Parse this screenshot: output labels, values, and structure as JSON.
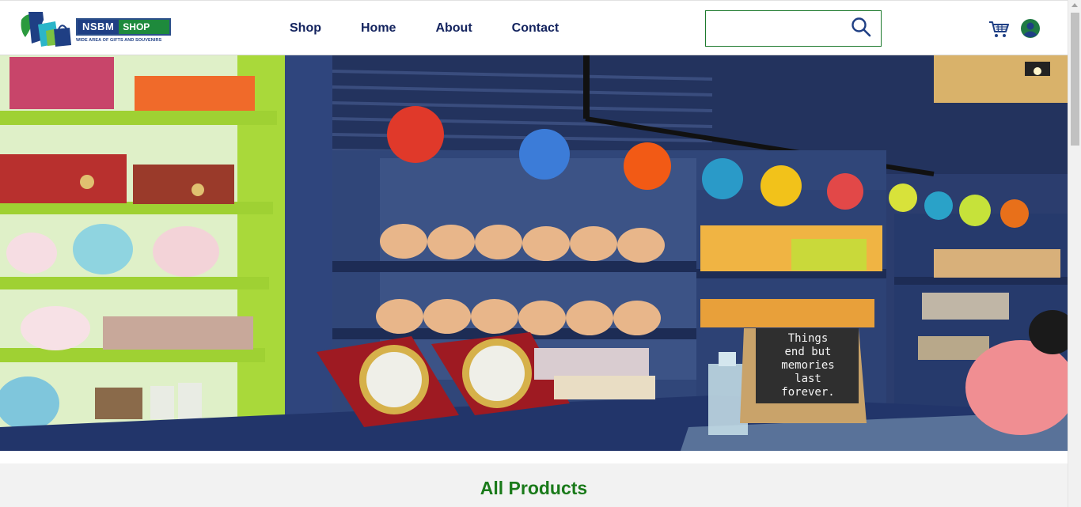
{
  "brand": {
    "name_part1": "NSBM",
    "name_part2": "SHOP",
    "tagline": "WIDE AREA OF GIFTS AND SOUVENIRS"
  },
  "nav": {
    "items": [
      {
        "label": "Shop"
      },
      {
        "label": "Home"
      },
      {
        "label": "About"
      },
      {
        "label": "Contact"
      }
    ]
  },
  "search": {
    "value": "",
    "placeholder": "",
    "icon": "search-icon"
  },
  "header_icons": {
    "cart": "cart-icon",
    "user": "user-icon"
  },
  "hero": {
    "chalkboard_text": [
      "Things",
      "end but",
      "memories",
      "last",
      "forever."
    ]
  },
  "products": {
    "title": "All Products"
  },
  "colors": {
    "nav_text": "#13235e",
    "accent_green": "#1a7a1a",
    "search_border": "#1e7a2e",
    "brand_blue": "#1f3f84"
  }
}
